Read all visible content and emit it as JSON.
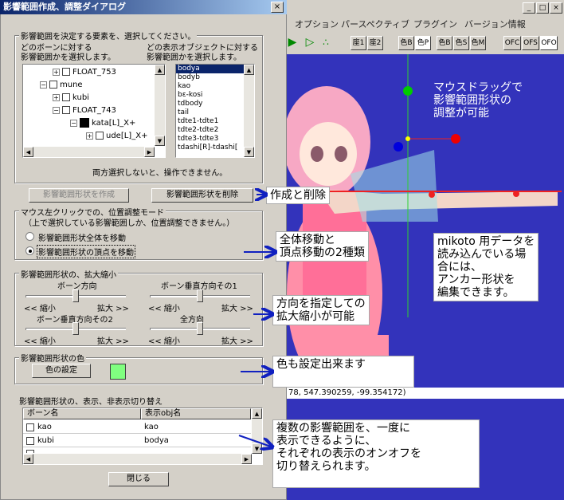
{
  "dialog": {
    "title": "影響範囲作成、調整ダイアログ",
    "close_glyph": "×",
    "element_group": {
      "label": "影響範囲を決定する要素を、選択してください。",
      "left_caption_1": "どのボーンに対する",
      "left_caption_2": "影響範囲かを選択します。",
      "right_caption_1": "どの表示オブジェクトに対する",
      "right_caption_2": "影響範囲かを選択します。",
      "tree": [
        "FLOAT_753",
        "mune",
        "kubi",
        "FLOAT_743",
        "kata[L]_X+",
        "ude[L]_X+"
      ],
      "list": [
        "bodya",
        "bodyb",
        "kao",
        "bε-kosi",
        "tdbody",
        "tail",
        "tdte1-tdte1",
        "tdte2-tdte2",
        "tdte3-tdte3",
        "tdashi[R]-tdashi["
      ],
      "note": "両方選択しないと、操作できません。"
    },
    "create_button": "影響範囲形状を作成",
    "delete_button": "影響範囲形状を削除",
    "mode_group": {
      "label": "マウス左クリックでの、位置調整モード",
      "note": "（上で選択している影響範囲しか、位置調整できません。）",
      "options": [
        "影響範囲形状全体を移動",
        "影響範囲形状の頂点を移動"
      ],
      "selected": 1
    },
    "scale_group": {
      "label": "影響範囲形状の、拡大縮小",
      "sliders": [
        {
          "title": "ボーン方向",
          "min_label": "<< 縮小",
          "max_label": "拡大 >>"
        },
        {
          "title": "ボーン垂直方向その1",
          "min_label": "<< 縮小",
          "max_label": "拡大 >>"
        },
        {
          "title": "ボーン垂直方向その2",
          "min_label": "<< 縮小",
          "max_label": "拡大 >>"
        },
        {
          "title": "全方向",
          "min_label": "<< 縮小",
          "max_label": "拡大 >>"
        }
      ]
    },
    "color_group": {
      "label": "影響範囲形状の色",
      "button": "色の設定",
      "swatch_color": "#80ff80"
    },
    "visibility": {
      "label": "影響範囲形状の、表示、非表示切り替え",
      "columns": [
        "ボーン名",
        "表示obj名"
      ],
      "rows": [
        {
          "bone": "kao",
          "obj": "kao"
        },
        {
          "bone": "kubi",
          "obj": "bodya"
        },
        {
          "bone": "",
          "obj": ""
        }
      ]
    },
    "close_button": "閉じる"
  },
  "app": {
    "menu": [
      "オプション",
      "パースペクティブ",
      "プラグイン",
      "バージョン情報"
    ],
    "window_buttons": [
      "_",
      "□",
      "×"
    ],
    "toolbar": [
      "座1",
      "座2",
      "色B",
      "色P",
      "色B",
      "色S",
      "色M",
      "OFC",
      "OFS",
      "OFO"
    ],
    "coords": "78, 547.390259, -99.354172)"
  },
  "callouts": {
    "drag": "マウスドラッグで\n影響範囲形状の\n調整が可能",
    "create_delete": "作成と削除",
    "move": "全体移動と\n頂点移動の2種類",
    "mikoto": "mikoto 用データを\n読み込んでいる場\n合には、\nアンカー形状を\n編集できます。",
    "scale": "方向を指定しての\n拡大縮小が可能",
    "color": "色も設定出来ます",
    "visibility": "複数の影響範囲を、一度に\n表示できるように、\nそれぞれの表示のオンオフを\n切り替えられます。"
  },
  "colors": {
    "viewport": "#3333bb",
    "titlebar": "#0a246a",
    "arrow": "#1020c0"
  }
}
